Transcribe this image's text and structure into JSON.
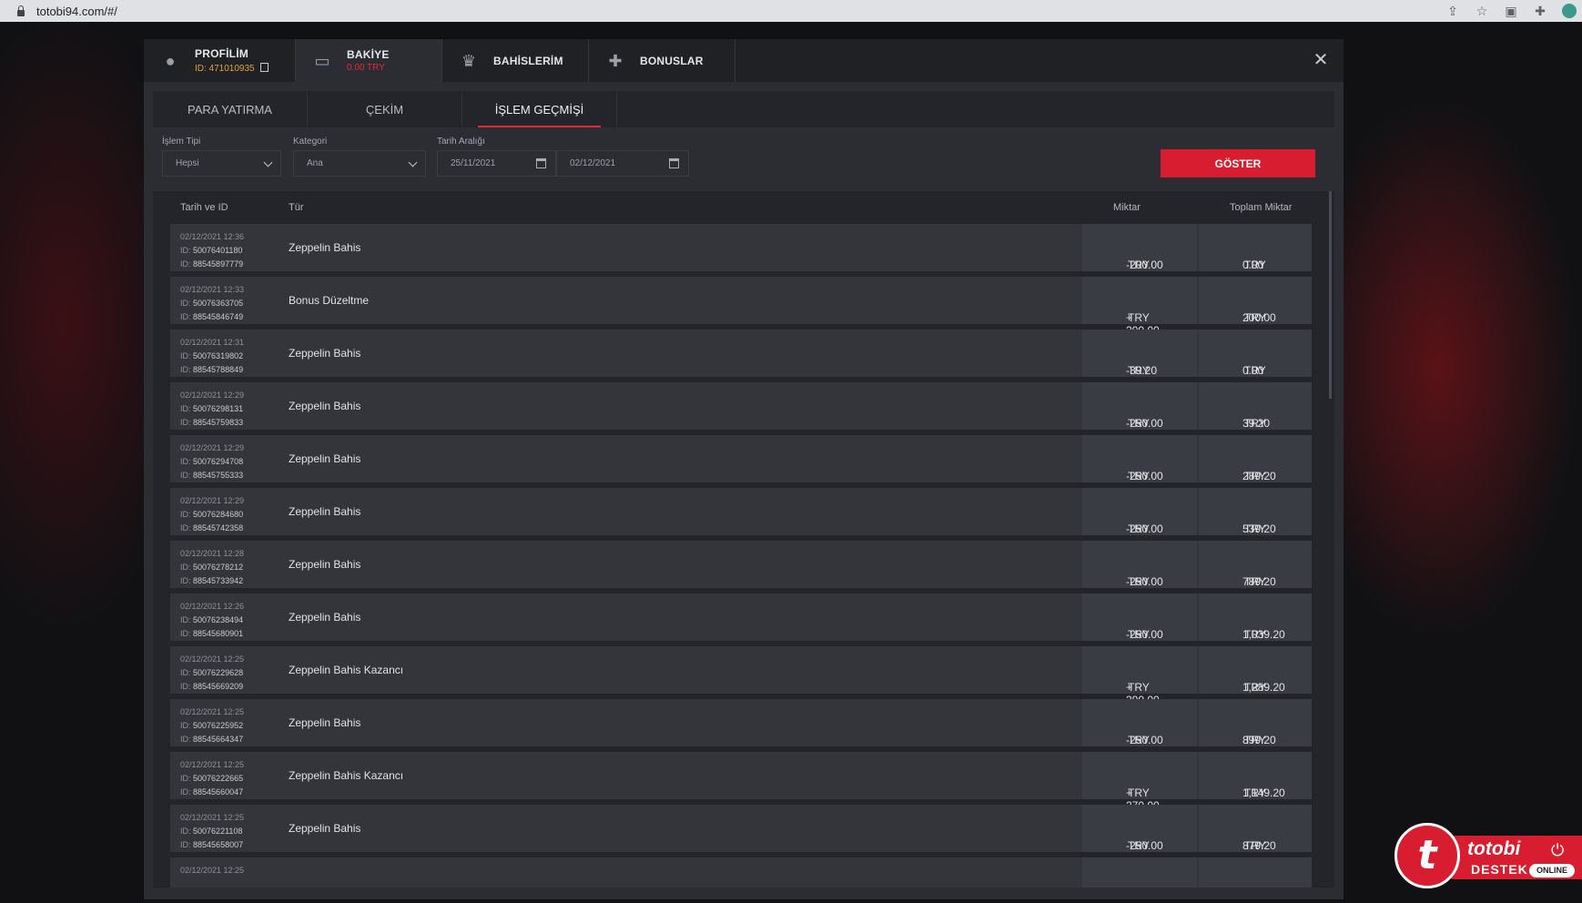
{
  "browser": {
    "url": "totobi94.com/#/"
  },
  "topnav": {
    "profile": {
      "label": "PROFİLİM",
      "sub": "ID: 471010935"
    },
    "balance": {
      "label": "BAKİYE",
      "sub": "0.00 TRY"
    },
    "bets": {
      "label": "BAHİSLERİM"
    },
    "bonuses": {
      "label": "BONUSLAR"
    },
    "close": "✕"
  },
  "tabs": [
    "PARA YATIRMA",
    "ÇEKİM",
    "İŞLEM GEÇMİŞİ"
  ],
  "filters": {
    "type_label": "İşlem Tipi",
    "type_value": "Hepsi",
    "category_label": "Kategori",
    "category_value": "Ana",
    "date_label": "Tarih Aralığı",
    "date_from": "25/11/2021",
    "date_to": "02/12/2021",
    "show_button": "GÖSTER"
  },
  "table": {
    "headers": {
      "date_id": "Tarih ve ID",
      "type": "Tür",
      "amount": "Miktar",
      "total": "Toplam Miktar"
    },
    "rows": [
      {
        "date": "02/12/2021 12:36",
        "id1_label": "ID:",
        "id1": "50076401180",
        "id2_label": "ID:",
        "id2": "88545897779",
        "type": "Zeppelin Bahis",
        "amount": "-200.00",
        "amount_cur": "TRY",
        "total": "0.00",
        "total_cur": "TRY"
      },
      {
        "date": "02/12/2021 12:33",
        "id1_label": "ID:",
        "id1": "50076363705",
        "id2_label": "ID:",
        "id2": "88545846749",
        "type": "Bonus Düzeltme",
        "amount": "+ 200.00",
        "amount_cur": "TRY",
        "total": "200.00",
        "total_cur": "TRY"
      },
      {
        "date": "02/12/2021 12:31",
        "id1_label": "ID:",
        "id1": "50076319802",
        "id2_label": "ID:",
        "id2": "88545788849",
        "type": "Zeppelin Bahis",
        "amount": "-39.20",
        "amount_cur": "TRY",
        "total": "0.00",
        "total_cur": "TRY"
      },
      {
        "date": "02/12/2021 12:29",
        "id1_label": "ID:",
        "id1": "50076298131",
        "id2_label": "ID:",
        "id2": "88545759833",
        "type": "Zeppelin Bahis",
        "amount": "-250.00",
        "amount_cur": "TRY",
        "total": "39.20",
        "total_cur": "TRY"
      },
      {
        "date": "02/12/2021 12:29",
        "id1_label": "ID:",
        "id1": "50076294708",
        "id2_label": "ID:",
        "id2": "88545755333",
        "type": "Zeppelin Bahis",
        "amount": "-250.00",
        "amount_cur": "TRY",
        "total": "289.20",
        "total_cur": "TRY"
      },
      {
        "date": "02/12/2021 12:29",
        "id1_label": "ID:",
        "id1": "50076284680",
        "id2_label": "ID:",
        "id2": "88545742358",
        "type": "Zeppelin Bahis",
        "amount": "-250.00",
        "amount_cur": "TRY",
        "total": "539.20",
        "total_cur": "TRY"
      },
      {
        "date": "02/12/2021 12:28",
        "id1_label": "ID:",
        "id1": "50076278212",
        "id2_label": "ID:",
        "id2": "88545733942",
        "type": "Zeppelin Bahis",
        "amount": "-250.00",
        "amount_cur": "TRY",
        "total": "789.20",
        "total_cur": "TRY"
      },
      {
        "date": "02/12/2021 12:26",
        "id1_label": "ID:",
        "id1": "50076238494",
        "id2_label": "ID:",
        "id2": "88545680901",
        "type": "Zeppelin Bahis",
        "amount": "-250.00",
        "amount_cur": "TRY",
        "total": "1,039.20",
        "total_cur": "TRY"
      },
      {
        "date": "02/12/2021 12:25",
        "id1_label": "ID:",
        "id1": "50076229628",
        "id2_label": "ID:",
        "id2": "88545669209",
        "type": "Zeppelin Bahis Kazancı",
        "amount": "+ 390.00",
        "amount_cur": "TRY",
        "total": "1,289.20",
        "total_cur": "TRY"
      },
      {
        "date": "02/12/2021 12:25",
        "id1_label": "ID:",
        "id1": "50076225952",
        "id2_label": "ID:",
        "id2": "88545664347",
        "type": "Zeppelin Bahis",
        "amount": "-250.00",
        "amount_cur": "TRY",
        "total": "899.20",
        "total_cur": "TRY"
      },
      {
        "date": "02/12/2021 12:25",
        "id1_label": "ID:",
        "id1": "50076222665",
        "id2_label": "ID:",
        "id2": "88545660047",
        "type": "Zeppelin Bahis Kazancı",
        "amount": "+ 270.00",
        "amount_cur": "TRY",
        "total": "1,149.20",
        "total_cur": "TRY"
      },
      {
        "date": "02/12/2021 12:25",
        "id1_label": "ID:",
        "id1": "50076221108",
        "id2_label": "ID:",
        "id2": "88545658007",
        "type": "Zeppelin Bahis",
        "amount": "-250.00",
        "amount_cur": "TRY",
        "total": "879.20",
        "total_cur": "TRY"
      },
      {
        "date": "02/12/2021 12:25",
        "id1_label": "",
        "id1": "",
        "id2_label": "",
        "id2": "",
        "type": "",
        "amount": "",
        "amount_cur": "",
        "total": "",
        "total_cur": ""
      }
    ]
  },
  "support": {
    "logo_letter": "t",
    "brand": "totobi",
    "label": "DESTEK",
    "status": "ONLINE"
  },
  "colors": {
    "accent_red": "#d71d2f",
    "profile_id": "#e0a33a",
    "balance_value": "#e02a3a"
  },
  "icons": [
    "lock-icon",
    "share-icon",
    "star-icon",
    "extension-icon",
    "puzzle-icon",
    "user-icon",
    "wallet-icon",
    "trophy-icon",
    "gift-icon",
    "copy-icon",
    "close-icon",
    "chevron-down-icon",
    "calendar-icon",
    "power-icon"
  ]
}
